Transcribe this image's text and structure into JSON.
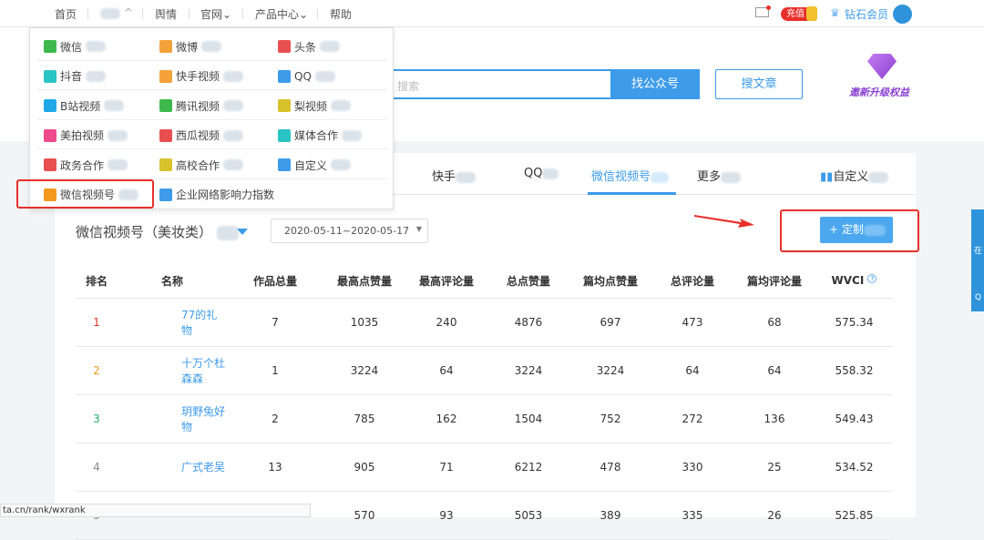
{
  "topnav": {
    "items": [
      "首页",
      "舆情",
      "官网",
      "产品中心",
      "帮助"
    ],
    "recharge": "充值",
    "vip": "钻石会员"
  },
  "header": {
    "search_placeholder": "搜索",
    "search_button": "找公众号",
    "article_button": "搜文章",
    "promo": "邀新升级权益"
  },
  "menu": {
    "items": [
      {
        "label": "微信",
        "color": "#3cb94a"
      },
      {
        "label": "微博",
        "color": "#f3a23a"
      },
      {
        "label": "头条",
        "color": "#e8504f"
      },
      {
        "label": "抖音",
        "color": "#2bc4c4"
      },
      {
        "label": "快手视频",
        "color": "#f3a23a"
      },
      {
        "label": "QQ",
        "color": "#3d9be9"
      },
      {
        "label": "B站视频",
        "color": "#20a8e8"
      },
      {
        "label": "腾讯视频",
        "color": "#3cb94a"
      },
      {
        "label": "梨视频",
        "color": "#d7c22e"
      },
      {
        "label": "美拍视频",
        "color": "#ee4a8c"
      },
      {
        "label": "西瓜视频",
        "color": "#e8504f"
      },
      {
        "label": "媒体合作",
        "color": "#2bc4c4"
      },
      {
        "label": "政务合作",
        "color": "#e8504f"
      },
      {
        "label": "高校合作",
        "color": "#d7c22e"
      },
      {
        "label": "自定义",
        "color": "#3d9be9"
      },
      {
        "label": "微信视频号",
        "color": "#f39a1e"
      },
      {
        "label": "企业网络影响力指数",
        "color": "#3d9be9"
      }
    ]
  },
  "tabs": {
    "items": [
      "快手",
      "QQ",
      "微信视频号",
      "更多"
    ],
    "custom": "自定义"
  },
  "main": {
    "title": "微信视频号（美妆类）",
    "date_range": "2020-05-11~2020-05-17",
    "custom_button": "+ 定制"
  },
  "table": {
    "headers": [
      "排名",
      "名称",
      "作品总量",
      "最高点赞量",
      "最高评论量",
      "总点赞量",
      "篇均点赞量",
      "总评论量",
      "篇均评论量",
      "WVCI"
    ],
    "rank_colors": [
      "#e8302c",
      "#f39a1e",
      "#2bae66",
      "#888",
      "#888"
    ],
    "rows": [
      [
        "1",
        "77的礼物",
        "7",
        "1035",
        "240",
        "4876",
        "697",
        "473",
        "68",
        "575.34"
      ],
      [
        "2",
        "十万个杜森森",
        "1",
        "3224",
        "64",
        "3224",
        "3224",
        "64",
        "64",
        "558.32"
      ],
      [
        "3",
        "玥野兔好物",
        "2",
        "785",
        "162",
        "1504",
        "752",
        "272",
        "136",
        "549.43"
      ],
      [
        "4",
        "广式老吴",
        "13",
        "905",
        "71",
        "6212",
        "478",
        "330",
        "25",
        "534.52"
      ],
      [
        "5",
        "",
        "",
        "570",
        "93",
        "5053",
        "389",
        "335",
        "26",
        "525.85"
      ]
    ]
  },
  "status_url": "ta.cn/rank/wxrank",
  "side": {
    "text1": "在",
    "text2": "Q"
  }
}
